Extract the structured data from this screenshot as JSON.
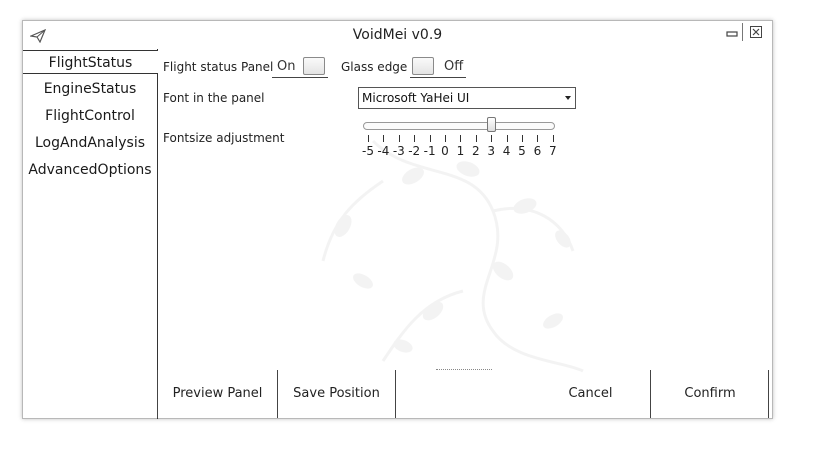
{
  "window": {
    "title": "VoidMei v0.9",
    "icons": {
      "app": "paper-plane-icon",
      "minimize": "minimize-icon",
      "close": "close-icon"
    }
  },
  "sidebar": {
    "items": [
      {
        "label": "FlightStatus",
        "active": true
      },
      {
        "label": "EngineStatus",
        "active": false
      },
      {
        "label": "FlightControl",
        "active": false
      },
      {
        "label": "LogAndAnalysis",
        "active": false
      },
      {
        "label": "AdvancedOptions",
        "active": false
      }
    ]
  },
  "settings": {
    "flight_status_panel": {
      "label": "Flight status Panel",
      "state": "On"
    },
    "glass_edge": {
      "label": "Glass edge",
      "state": "Off"
    },
    "font": {
      "label": "Font in the panel",
      "value": "Microsoft YaHei UI"
    },
    "fontsize": {
      "label": "Fontsize adjustment",
      "value": 3,
      "min": -5,
      "max": 7,
      "ticks": [
        "-5",
        "-4",
        "-3",
        "-2",
        "-1",
        "0",
        "1",
        "2",
        "3",
        "4",
        "5",
        "6",
        "7"
      ]
    }
  },
  "footer": {
    "preview": "Preview Panel",
    "save_position": "Save Position",
    "cancel": "Cancel",
    "confirm": "Confirm"
  },
  "colors": {
    "border": "#333333",
    "window_border": "#b8b8b8",
    "watermark": "#cfcfcf"
  }
}
